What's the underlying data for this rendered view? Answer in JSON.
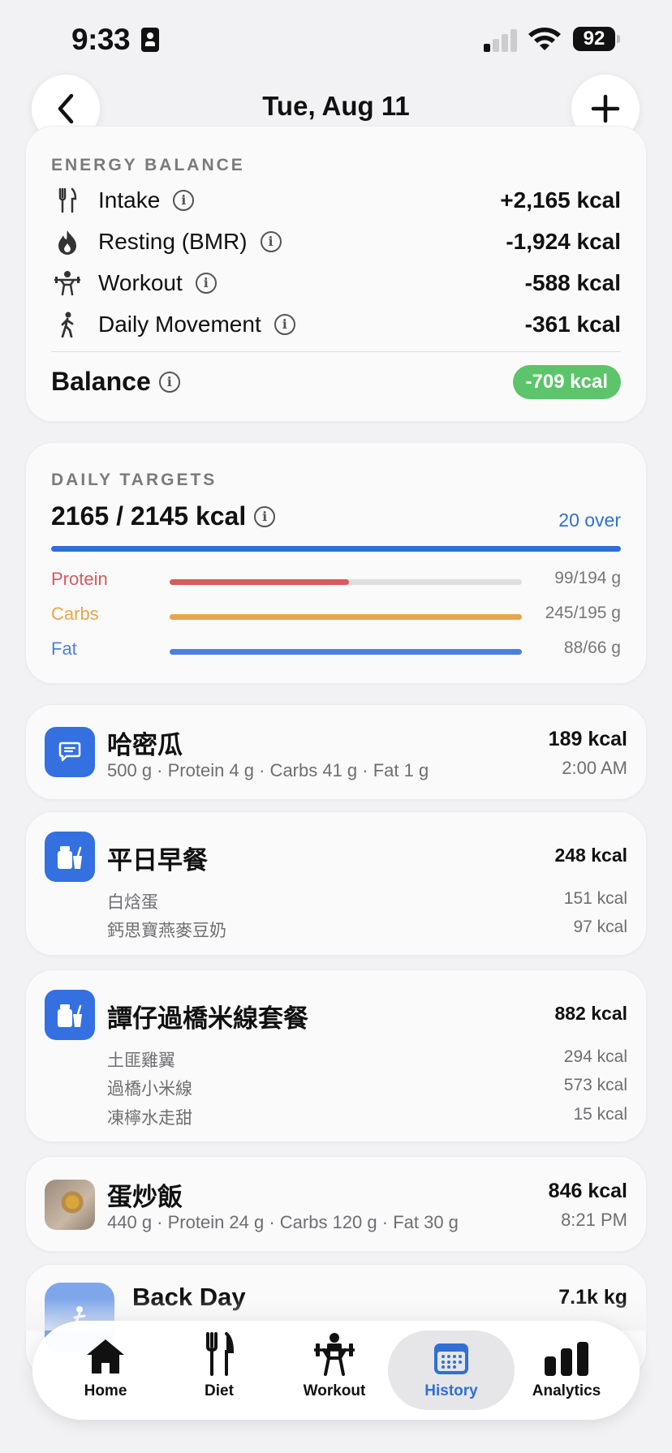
{
  "status_bar": {
    "time": "9:33",
    "battery": "92"
  },
  "header": {
    "title": "Tue, Aug 11"
  },
  "energy_balance": {
    "section_label": "ENERGY BALANCE",
    "rows": [
      {
        "label": "Intake",
        "value": "+2,165 kcal",
        "icon": "fork-knife-icon"
      },
      {
        "label": "Resting (BMR)",
        "value": "-1,924 kcal",
        "icon": "flame-icon"
      },
      {
        "label": "Workout",
        "value": "-588 kcal",
        "icon": "weightlifter-icon"
      },
      {
        "label": "Daily Movement",
        "value": "-361 kcal",
        "icon": "walking-icon"
      }
    ],
    "balance_label": "Balance",
    "balance_value": "-709 kcal",
    "balance_color": "#5cc46a"
  },
  "daily_targets": {
    "section_label": "DAILY TARGETS",
    "main": "2165 / 2145 kcal",
    "status": "20 over",
    "progress_fraction": 1.0,
    "macros": [
      {
        "label": "Protein",
        "value": "99/194 g",
        "fraction": 0.51,
        "color": "#d85a5a"
      },
      {
        "label": "Carbs",
        "value": "245/195 g",
        "fraction": 1.0,
        "color": "#e9a54a"
      },
      {
        "label": "Fat",
        "value": "88/66 g",
        "fraction": 1.0,
        "color": "#4f7fdc"
      }
    ]
  },
  "entries": [
    {
      "name": "哈密瓜",
      "detail": "500 g · Protein 4 g · Carbs 41 g · Fat 1 g",
      "kcal": "189 kcal",
      "time": "2:00 AM",
      "icon": "chat-bubble-icon"
    },
    {
      "name": "平日早餐",
      "kcal": "248 kcal",
      "icon": "meal-container-icon",
      "items": [
        {
          "name": "白焓蛋",
          "kcal": "151 kcal"
        },
        {
          "name": "鈣思寶燕麥豆奶",
          "kcal": "97 kcal"
        }
      ]
    },
    {
      "name": "譚仔過橋米線套餐",
      "kcal": "882 kcal",
      "icon": "meal-container-icon",
      "items": [
        {
          "name": "土匪雞翼",
          "kcal": "294 kcal"
        },
        {
          "name": "過橋小米線",
          "kcal": "573 kcal"
        },
        {
          "name": "凍檸水走甜",
          "kcal": "15 kcal"
        }
      ]
    },
    {
      "name": "蛋炒飯",
      "detail": "440 g · Protein 24 g · Carbs 120 g · Fat 30 g",
      "kcal": "846 kcal",
      "time": "8:21 PM",
      "icon": "food-photo"
    },
    {
      "name": "Back Day",
      "value": "7.1k kg",
      "icon": "rowing-icon"
    }
  ],
  "tabs": [
    {
      "label": "Home",
      "icon": "home-icon"
    },
    {
      "label": "Diet",
      "icon": "fork-knife-icon"
    },
    {
      "label": "Workout",
      "icon": "weightlifter-icon"
    },
    {
      "label": "History",
      "icon": "calendar-icon",
      "active": true
    },
    {
      "label": "Analytics",
      "icon": "bar-chart-icon"
    }
  ],
  "colors": {
    "accent": "#2f6fd6",
    "icon_bg": "#3470e0"
  }
}
